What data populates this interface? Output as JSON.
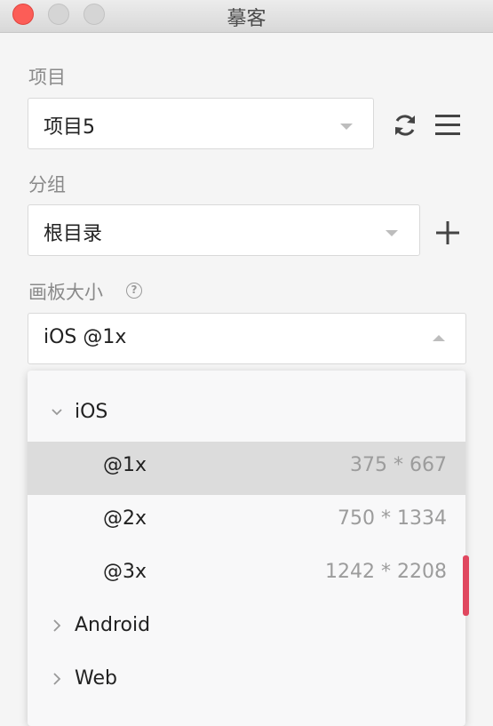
{
  "window": {
    "title": "摹客"
  },
  "project": {
    "label": "项目",
    "selected": "项目5"
  },
  "group": {
    "label": "分组",
    "selected": "根目录"
  },
  "artboard": {
    "label": "画板大小",
    "selected": "iOS @1x",
    "options": [
      {
        "name": "iOS",
        "expanded": true
      },
      {
        "name": "@1x",
        "size": "375 * 667",
        "selected": true
      },
      {
        "name": "@2x",
        "size": "750 * 1334"
      },
      {
        "name": "@3x",
        "size": "1242 * 2208"
      },
      {
        "name": "Android",
        "expanded": false
      },
      {
        "name": "Web",
        "expanded": false
      }
    ]
  },
  "colors": {
    "selected_row": "#dcdcdc",
    "accent_mark": "#e0475f"
  }
}
